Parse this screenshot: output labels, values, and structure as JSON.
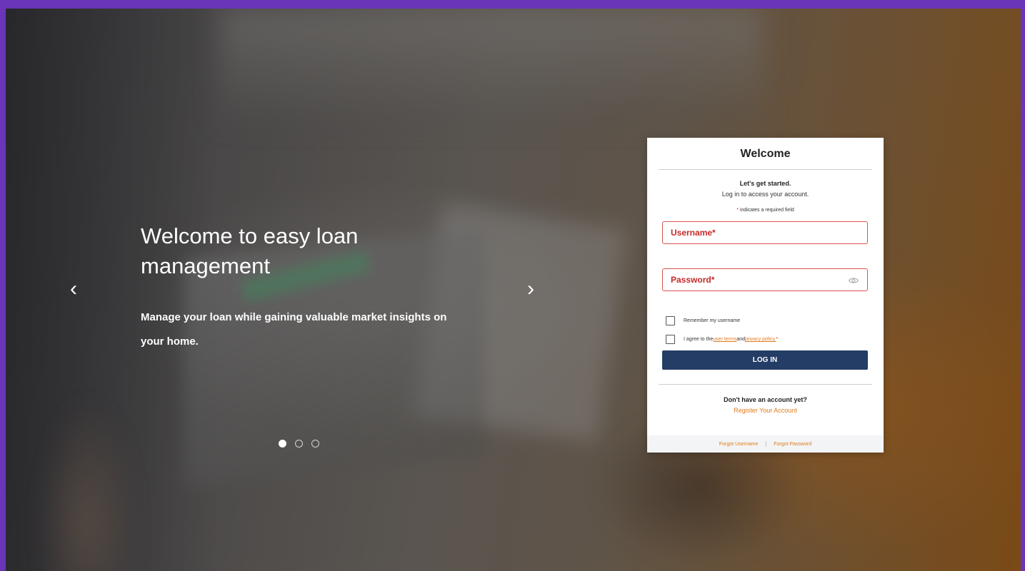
{
  "hero": {
    "title": "Welcome to easy loan management",
    "subtitle": "Manage your loan while gaining valuable market insights on your home.",
    "prev_arrow": "‹",
    "next_arrow": "›",
    "slide_count": 3,
    "active_slide": 1
  },
  "login": {
    "title": "Welcome",
    "intro_line1": "Let's get started.",
    "intro_line2": "Log in to access your account.",
    "required_star": "*",
    "required_note": " indicates a required field",
    "username_placeholder": "Username*",
    "password_placeholder": "Password*",
    "remember_label": "Remember my username",
    "agree_prefix": "I agree to the ",
    "user_terms_link": "user terms",
    "agree_middle": " and ",
    "privacy_link": "privacy policy.",
    "agree_star": " *",
    "login_button": "LOG IN",
    "no_account_text": "Don't have an account yet?",
    "register_link": "Register Your Account",
    "forgot_username": "Forgot Username",
    "footer_separator": "|",
    "forgot_password": "Forgot Password"
  },
  "colors": {
    "frame_border": "#6a35b8",
    "primary_button": "#243d66",
    "accent_link": "#e07b1a",
    "error_red": "#c62828"
  },
  "icons": {
    "password_toggle": "eye-icon"
  }
}
